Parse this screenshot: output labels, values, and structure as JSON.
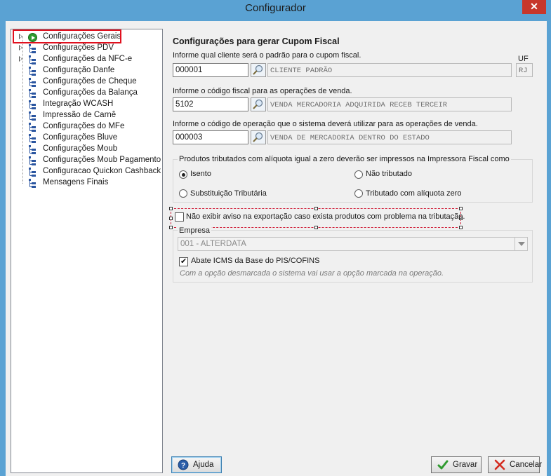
{
  "window": {
    "title": "Configurador",
    "close": "✕"
  },
  "tree": {
    "items": [
      {
        "label": "Configurações Gerais",
        "expandable": true
      },
      {
        "label": "Configurações PDV",
        "expandable": true
      },
      {
        "label": "Configurações da NFC-e",
        "expandable": true
      },
      {
        "label": "Configuração Danfe",
        "expandable": false
      },
      {
        "label": "Configurações de Cheque",
        "expandable": false
      },
      {
        "label": "Configurações da Balança",
        "expandable": false
      },
      {
        "label": "Integração WCASH",
        "expandable": false
      },
      {
        "label": "Impressão de Carnê",
        "expandable": false
      },
      {
        "label": "Configurações do MFe",
        "expandable": false
      },
      {
        "label": "Configurações Bluve",
        "expandable": false
      },
      {
        "label": "Configurações Moub",
        "expandable": false
      },
      {
        "label": "Configurações Moub Pagamento",
        "expandable": false
      },
      {
        "label": "Configuracao Quickon Cashback",
        "expandable": false
      },
      {
        "label": "Mensagens Finais",
        "expandable": false
      }
    ]
  },
  "panel": {
    "title": "Configurações para gerar Cupom Fiscal",
    "cliente": {
      "label": "Informe qual cliente será o padrão para o cupom fiscal.",
      "code": "000001",
      "name": "CLIENTE PADRÃO",
      "uf_label": "UF",
      "uf": "RJ"
    },
    "fiscal": {
      "label": "Informe o código fiscal para as operações de venda.",
      "code": "5102",
      "name": "VENDA MERCADORIA ADQUIRIDA RECEB TERCEIR"
    },
    "operacao": {
      "label": "Informe o código de operação que o sistema deverá utilizar para as operações de venda.",
      "code": "000003",
      "name": "VENDA DE MERCADORIA DENTRO DO ESTADO"
    },
    "aliquota": {
      "title": "Produtos tributados com alíquota igual a zero deverão ser impressos na Impressora Fiscal como",
      "options": [
        "Isento",
        "Não tributado",
        "Substituição Tributária",
        "Tributado com alíquota zero"
      ],
      "selected": 0
    },
    "aviso_checkbox": "Não exibir aviso na exportação caso exista produtos com problema na tributação.",
    "empresa": {
      "title": "Empresa",
      "value": "001 - ALTERDATA",
      "abate_checkbox": "Abate ICMS da Base do PIS/COFINS",
      "hint": "Com a opção desmarcada o sistema vai usar a opção marcada na operação."
    }
  },
  "buttons": {
    "help": "Ajuda",
    "save": "Gravar",
    "cancel": "Cancelar"
  }
}
